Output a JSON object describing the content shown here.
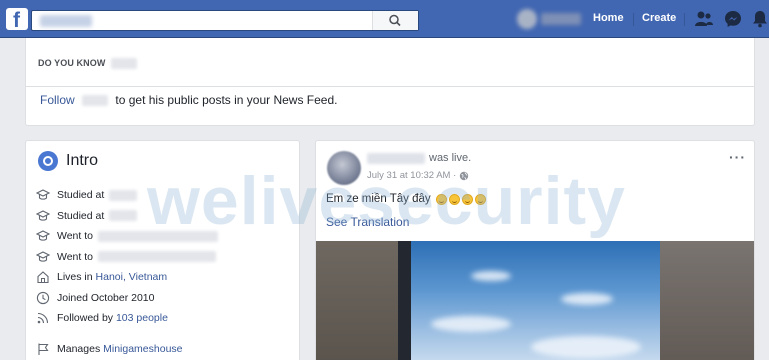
{
  "topbar": {
    "logo": "f",
    "nav": {
      "home": "Home",
      "create": "Create"
    },
    "icons": [
      "friends-icon",
      "messenger-icon",
      "notifications-icon"
    ],
    "brand_color": "#4267b2"
  },
  "do_you_know": {
    "heading": "DO YOU KNOW",
    "follow_link": "Follow",
    "follow_text": "to get his public posts in your News Feed."
  },
  "intro": {
    "title": "Intro",
    "items": [
      {
        "icon": "graduation-cap-icon",
        "text": "Studied at"
      },
      {
        "icon": "graduation-cap-icon",
        "text": "Studied at"
      },
      {
        "icon": "graduation-cap-icon",
        "text": "Went to"
      },
      {
        "icon": "graduation-cap-icon",
        "text": "Went to"
      },
      {
        "icon": "home-icon",
        "text": "Lives in",
        "link": "Hanoi, Vietnam"
      },
      {
        "icon": "clock-icon",
        "text": "Joined October 2010"
      },
      {
        "icon": "rss-icon",
        "text": "Followed by",
        "link": "103 people"
      },
      {
        "icon": "flag-icon",
        "text": "Manages",
        "link": "Minigameshouse"
      }
    ]
  },
  "post": {
    "status": "was live.",
    "timestamp": "July 31 at 10:32 AM ·",
    "text": "Em ze miền Tây đây",
    "emoji_count": 4,
    "translate": "See Translation",
    "more": "···"
  },
  "watermark": "welivesecurity"
}
